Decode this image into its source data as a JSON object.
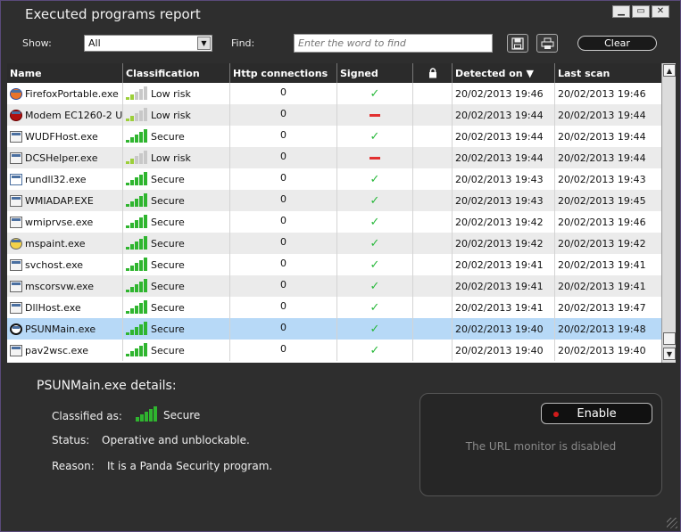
{
  "window": {
    "title": "Executed programs report",
    "minimize": "▁",
    "maximize": "▭",
    "close": "✕"
  },
  "toolbar": {
    "show_label": "Show:",
    "show_value": "All",
    "find_label": "Find:",
    "find_placeholder": "Enter the word to find",
    "save_icon": "save-icon",
    "print_icon": "print-icon",
    "clear_label": "Clear"
  },
  "columns": [
    "Name",
    "Classification",
    "Http connections",
    "Signed",
    "",
    "Detected on ▼",
    "Last scan"
  ],
  "risk_colors": {
    "secure": "#2fb52f",
    "low": "#9ccf3a",
    "empty": "#c8c8c8"
  },
  "rows": [
    {
      "name": "FirefoxPortable.exe",
      "icon": "firefox-icon",
      "class": "Low risk",
      "level": 2,
      "http": "0",
      "signed": "yes",
      "detected": "20/02/2013 19:46",
      "last": "20/02/2013 19:46"
    },
    {
      "name": "Modem EC1260-2 U...",
      "icon": "modem-icon",
      "class": "Low risk",
      "level": 2,
      "http": "0",
      "signed": "no",
      "detected": "20/02/2013 19:44",
      "last": "20/02/2013 19:44"
    },
    {
      "name": "WUDFHost.exe",
      "icon": "program-icon",
      "class": "Secure",
      "level": 5,
      "http": "0",
      "signed": "yes",
      "detected": "20/02/2013 19:44",
      "last": "20/02/2013 19:44"
    },
    {
      "name": "DCSHelper.exe",
      "icon": "program-icon",
      "class": "Low risk",
      "level": 2,
      "http": "0",
      "signed": "no",
      "detected": "20/02/2013 19:44",
      "last": "20/02/2013 19:44"
    },
    {
      "name": "rundll32.exe",
      "icon": "document-icon",
      "class": "Secure",
      "level": 5,
      "http": "0",
      "signed": "yes",
      "detected": "20/02/2013 19:43",
      "last": "20/02/2013 19:43"
    },
    {
      "name": "WMIADAP.EXE",
      "icon": "program-icon",
      "class": "Secure",
      "level": 5,
      "http": "0",
      "signed": "yes",
      "detected": "20/02/2013 19:43",
      "last": "20/02/2013 19:45"
    },
    {
      "name": "wmiprvse.exe",
      "icon": "program-icon",
      "class": "Secure",
      "level": 5,
      "http": "0",
      "signed": "yes",
      "detected": "20/02/2013 19:42",
      "last": "20/02/2013 19:46"
    },
    {
      "name": "mspaint.exe",
      "icon": "paint-icon",
      "class": "Secure",
      "level": 5,
      "http": "0",
      "signed": "yes",
      "detected": "20/02/2013 19:42",
      "last": "20/02/2013 19:42"
    },
    {
      "name": "svchost.exe",
      "icon": "program-icon",
      "class": "Secure",
      "level": 5,
      "http": "0",
      "signed": "yes",
      "detected": "20/02/2013 19:41",
      "last": "20/02/2013 19:41"
    },
    {
      "name": "mscorsvw.exe",
      "icon": "program-icon",
      "class": "Secure",
      "level": 5,
      "http": "0",
      "signed": "yes",
      "detected": "20/02/2013 19:41",
      "last": "20/02/2013 19:41"
    },
    {
      "name": "DllHost.exe",
      "icon": "program-icon",
      "class": "Secure",
      "level": 5,
      "http": "0",
      "signed": "yes",
      "detected": "20/02/2013 19:41",
      "last": "20/02/2013 19:47"
    },
    {
      "name": "PSUNMain.exe",
      "icon": "panda-icon",
      "class": "Secure",
      "level": 5,
      "http": "0",
      "signed": "yes",
      "detected": "20/02/2013 19:40",
      "last": "20/02/2013 19:48",
      "selected": true
    },
    {
      "name": "pav2wsc.exe",
      "icon": "program-icon",
      "class": "Secure",
      "level": 5,
      "http": "0",
      "signed": "yes",
      "detected": "20/02/2013 19:40",
      "last": "20/02/2013 19:40"
    }
  ],
  "details": {
    "title": "PSUNMain.exe details:",
    "classified_label": "Classified as:",
    "classified_value": "Secure",
    "status_label": "Status:",
    "status_value": "Operative and unblockable.",
    "reason_label": "Reason:",
    "reason_value": "It is a Panda Security program."
  },
  "url_monitor": {
    "enable_label": "Enable",
    "status": "The URL monitor is disabled"
  }
}
